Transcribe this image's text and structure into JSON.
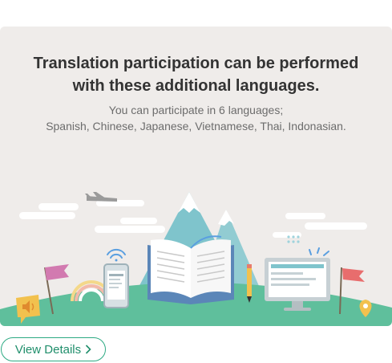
{
  "banner": {
    "headline_line1": "Translation participation can be performed",
    "headline_line2": "with these additional languages.",
    "subline1": "You can participate in 6 languages;",
    "subline2": "Spanish, Chinese, Japanese, Vietnamese, Thai, Indonasian."
  },
  "cta": {
    "label": "View Details",
    "icon": "chevron-right-icon"
  },
  "colors": {
    "card_bg": "#efecea",
    "accent_green": "#2daa83",
    "ground": "#5fbf9c",
    "headline": "#333333"
  }
}
